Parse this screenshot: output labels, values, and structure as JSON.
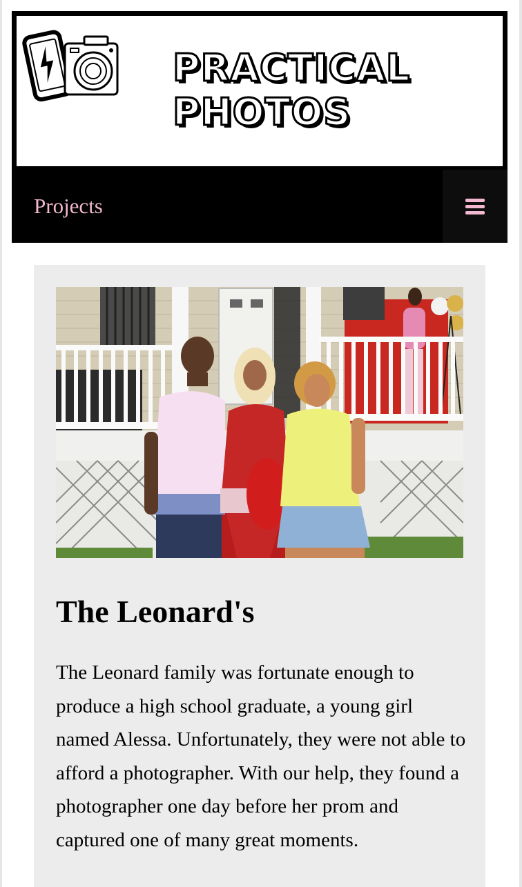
{
  "site": {
    "title_line1": "PRACTICAL",
    "title_line2": "PHOTOS",
    "logo_icon": "phone-camera-logo-icon"
  },
  "nav": {
    "link_label": "Projects",
    "menu_icon": "hamburger-menu-icon"
  },
  "colors": {
    "nav_background": "#000000",
    "nav_link": "#f2b8cf",
    "card_background": "#ececec"
  },
  "project": {
    "image_subject": "family-portrait-photo",
    "title": "The Leonard's",
    "description": "The Leonard family was fortunate enough to produce a high school graduate, a young girl named Alessa. Unfortunately, they were not able to afford a photographer. With our help, they found a photographer one day before her prom and captured one of many great moments."
  }
}
